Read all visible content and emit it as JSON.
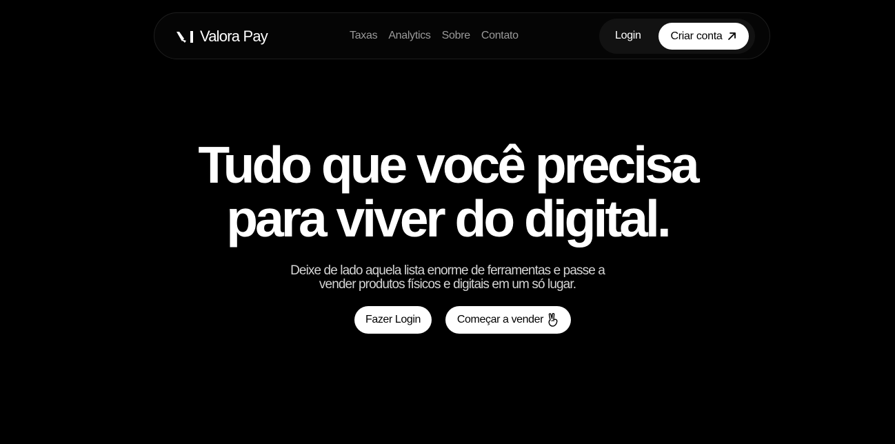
{
  "brand": {
    "name": "Valora Pay",
    "logo_icon": "valora-logo-icon"
  },
  "nav": {
    "links": [
      "Taxas",
      "Analytics",
      "Sobre",
      "Contato"
    ]
  },
  "auth": {
    "login_label": "Login",
    "signup_label": "Criar conta",
    "signup_icon": "arrow-up-right-icon"
  },
  "hero": {
    "title_line1": "Tudo que você precisa",
    "title_line2": "para viver do digital.",
    "subtitle_line1": "Deixe de lado aquela lista enorme de ferramentas e passe a",
    "subtitle_line2": "vender produtos físicos e digitais em um só lugar.",
    "cta_login": "Fazer Login",
    "cta_start": "Começar a vender",
    "cta_start_icon": "victory-hand-icon"
  },
  "colors": {
    "background": "#000000",
    "text": "#ffffff",
    "nav_muted": "#9a9a9a",
    "subtitle": "#d4d4d4",
    "button_bg": "#ffffff",
    "button_text": "#000000"
  }
}
